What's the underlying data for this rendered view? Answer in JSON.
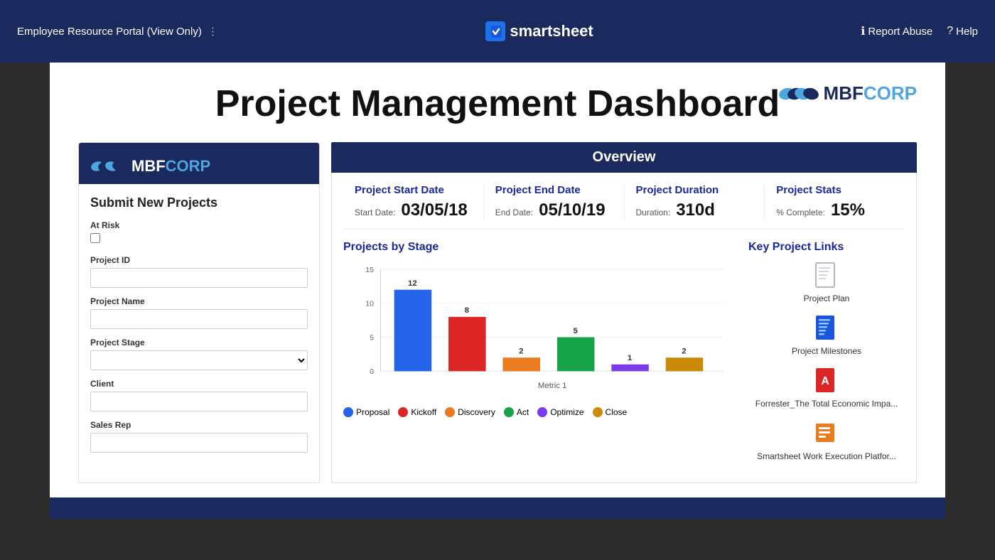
{
  "topbar": {
    "portal_name": "Employee Resource Portal (View Only)",
    "dots_label": "⋮",
    "logo_check": "✓",
    "logo_text": "smartsheet",
    "report_abuse_label": "Report Abuse",
    "help_label": "Help"
  },
  "page": {
    "title": "Project Management Dashboard"
  },
  "mbfcorp": {
    "label": "MBFCORP",
    "prefix": "MBF"
  },
  "overview": {
    "header": "Overview",
    "stats": [
      {
        "title": "Project Start Date",
        "label": "Start Date:",
        "value": "03/05/18"
      },
      {
        "title": "Project End Date",
        "label": "End Date:",
        "value": "05/10/19"
      },
      {
        "title": "Project Duration",
        "label": "Duration:",
        "value": "310d"
      },
      {
        "title": "Project Stats",
        "label": "% Complete:",
        "value": "15%"
      }
    ]
  },
  "chart": {
    "title": "Projects by Stage",
    "x_label": "Metric 1",
    "bars": [
      {
        "label": "Proposal",
        "value": 12,
        "color": "#2563eb"
      },
      {
        "label": "Kickoff",
        "value": 8,
        "color": "#dc2626"
      },
      {
        "label": "Discovery",
        "value": 2,
        "color": "#ea7c1f"
      },
      {
        "label": "Act",
        "value": 5,
        "color": "#16a34a"
      },
      {
        "label": "Optimize",
        "value": 1,
        "color": "#7c3aed"
      },
      {
        "label": "Close",
        "value": 2,
        "color": "#ca8a04"
      }
    ],
    "y_max": 15,
    "y_ticks": [
      0,
      5,
      10,
      15
    ]
  },
  "form": {
    "title": "Submit New Projects",
    "at_risk_label": "At Risk",
    "project_id_label": "Project ID",
    "project_name_label": "Project Name",
    "project_stage_label": "Project Stage",
    "client_label": "Client",
    "sales_rep_label": "Sales Rep"
  },
  "key_links": {
    "title": "Key Project Links",
    "items": [
      {
        "label": "Project Plan",
        "icon_type": "doc",
        "color": "#6b7280"
      },
      {
        "label": "Project Milestones",
        "icon_type": "doc-blue",
        "color": "#1a56db"
      },
      {
        "label": "Forrester_The Total Economic Impa...",
        "icon_type": "pdf",
        "color": "#dc2626"
      },
      {
        "label": "Smartsheet Work Execution Platfor...",
        "icon_type": "sheet",
        "color": "#ea7c1f"
      }
    ]
  }
}
